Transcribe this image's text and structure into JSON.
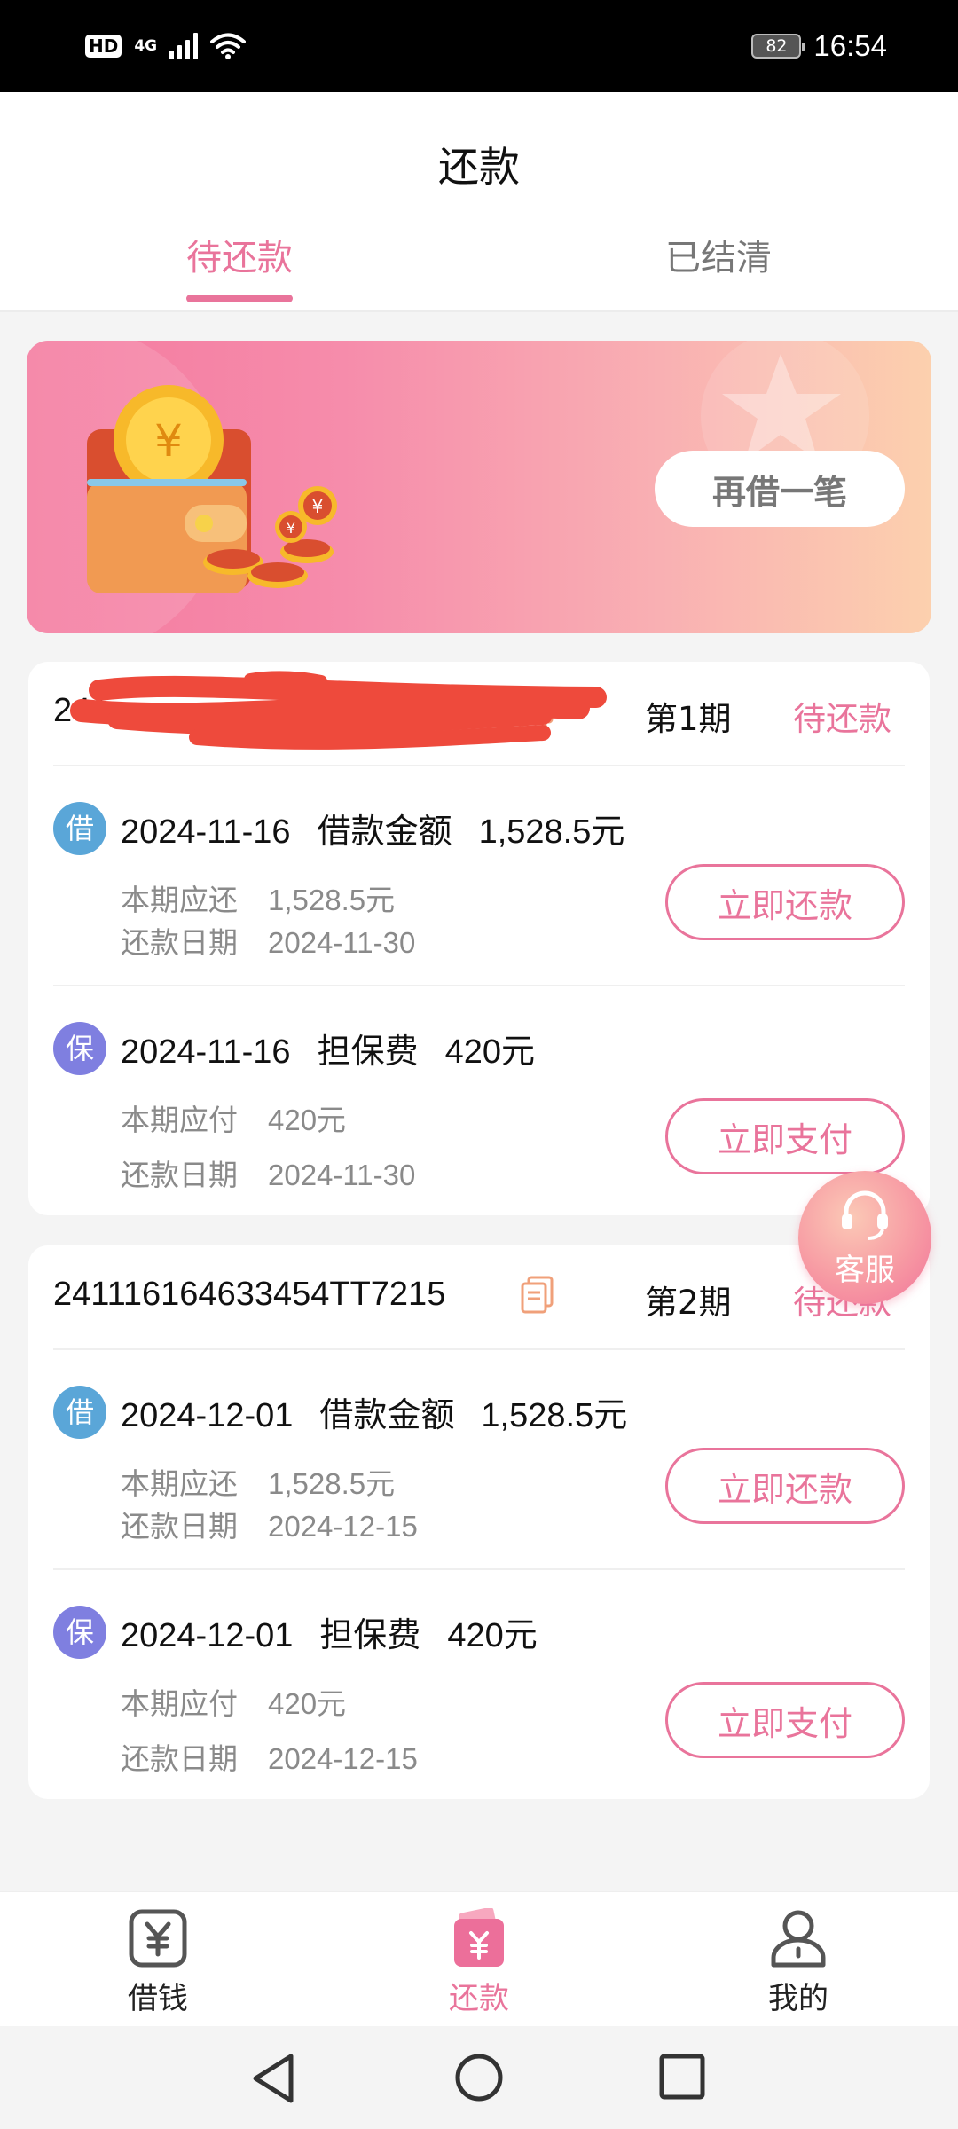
{
  "status_bar": {
    "hd": "HD",
    "network": "4G",
    "battery": "82",
    "time": "16:54"
  },
  "header": {
    "title": "还款",
    "tabs": [
      {
        "label": "待还款",
        "active": true
      },
      {
        "label": "已结清",
        "active": false
      }
    ]
  },
  "banner": {
    "button_label": "再借一笔"
  },
  "cards": [
    {
      "order_no_visible": "241",
      "order_no_redacted": true,
      "period": "第1期",
      "status": "待还款",
      "items": [
        {
          "badge": "借",
          "date": "2024-11-16",
          "title": "借款金额",
          "amount": "1,528.5元",
          "detail1_label": "本期应还",
          "detail1_value": "1,528.5元",
          "detail2_label": "还款日期",
          "detail2_value": "2024-11-30",
          "button": "立即还款"
        },
        {
          "badge": "保",
          "date": "2024-11-16",
          "title": "担保费",
          "amount": "420元",
          "detail1_label": "本期应付",
          "detail1_value": "420元",
          "detail2_label": "还款日期",
          "detail2_value": "2024-11-30",
          "button": "立即支付"
        }
      ]
    },
    {
      "order_no_visible": "241116164633454TT7215",
      "order_no_redacted": false,
      "period": "第2期",
      "status": "待还款",
      "items": [
        {
          "badge": "借",
          "date": "2024-12-01",
          "title": "借款金额",
          "amount": "1,528.5元",
          "detail1_label": "本期应还",
          "detail1_value": "1,528.5元",
          "detail2_label": "还款日期",
          "detail2_value": "2024-12-15",
          "button": "立即还款"
        },
        {
          "badge": "保",
          "date": "2024-12-01",
          "title": "担保费",
          "amount": "420元",
          "detail1_label": "本期应付",
          "detail1_value": "420元",
          "detail2_label": "还款日期",
          "detail2_value": "2024-12-15",
          "button": "立即支付"
        }
      ]
    }
  ],
  "service": {
    "label": "客服",
    "icon": "headset-icon"
  },
  "bottom_nav": [
    {
      "label": "借钱",
      "icon": "yuan-box-icon",
      "active": false
    },
    {
      "label": "还款",
      "icon": "repay-wallet-icon",
      "active": true
    },
    {
      "label": "我的",
      "icon": "person-icon",
      "active": false
    }
  ],
  "system_nav": [
    "back-icon",
    "home-icon",
    "recents-icon"
  ],
  "colors": {
    "accent": "#e9749b",
    "loan_badge": "#5aa6d8",
    "guarantee_badge": "#7f7fe0",
    "redaction": "#ee4a3c"
  }
}
